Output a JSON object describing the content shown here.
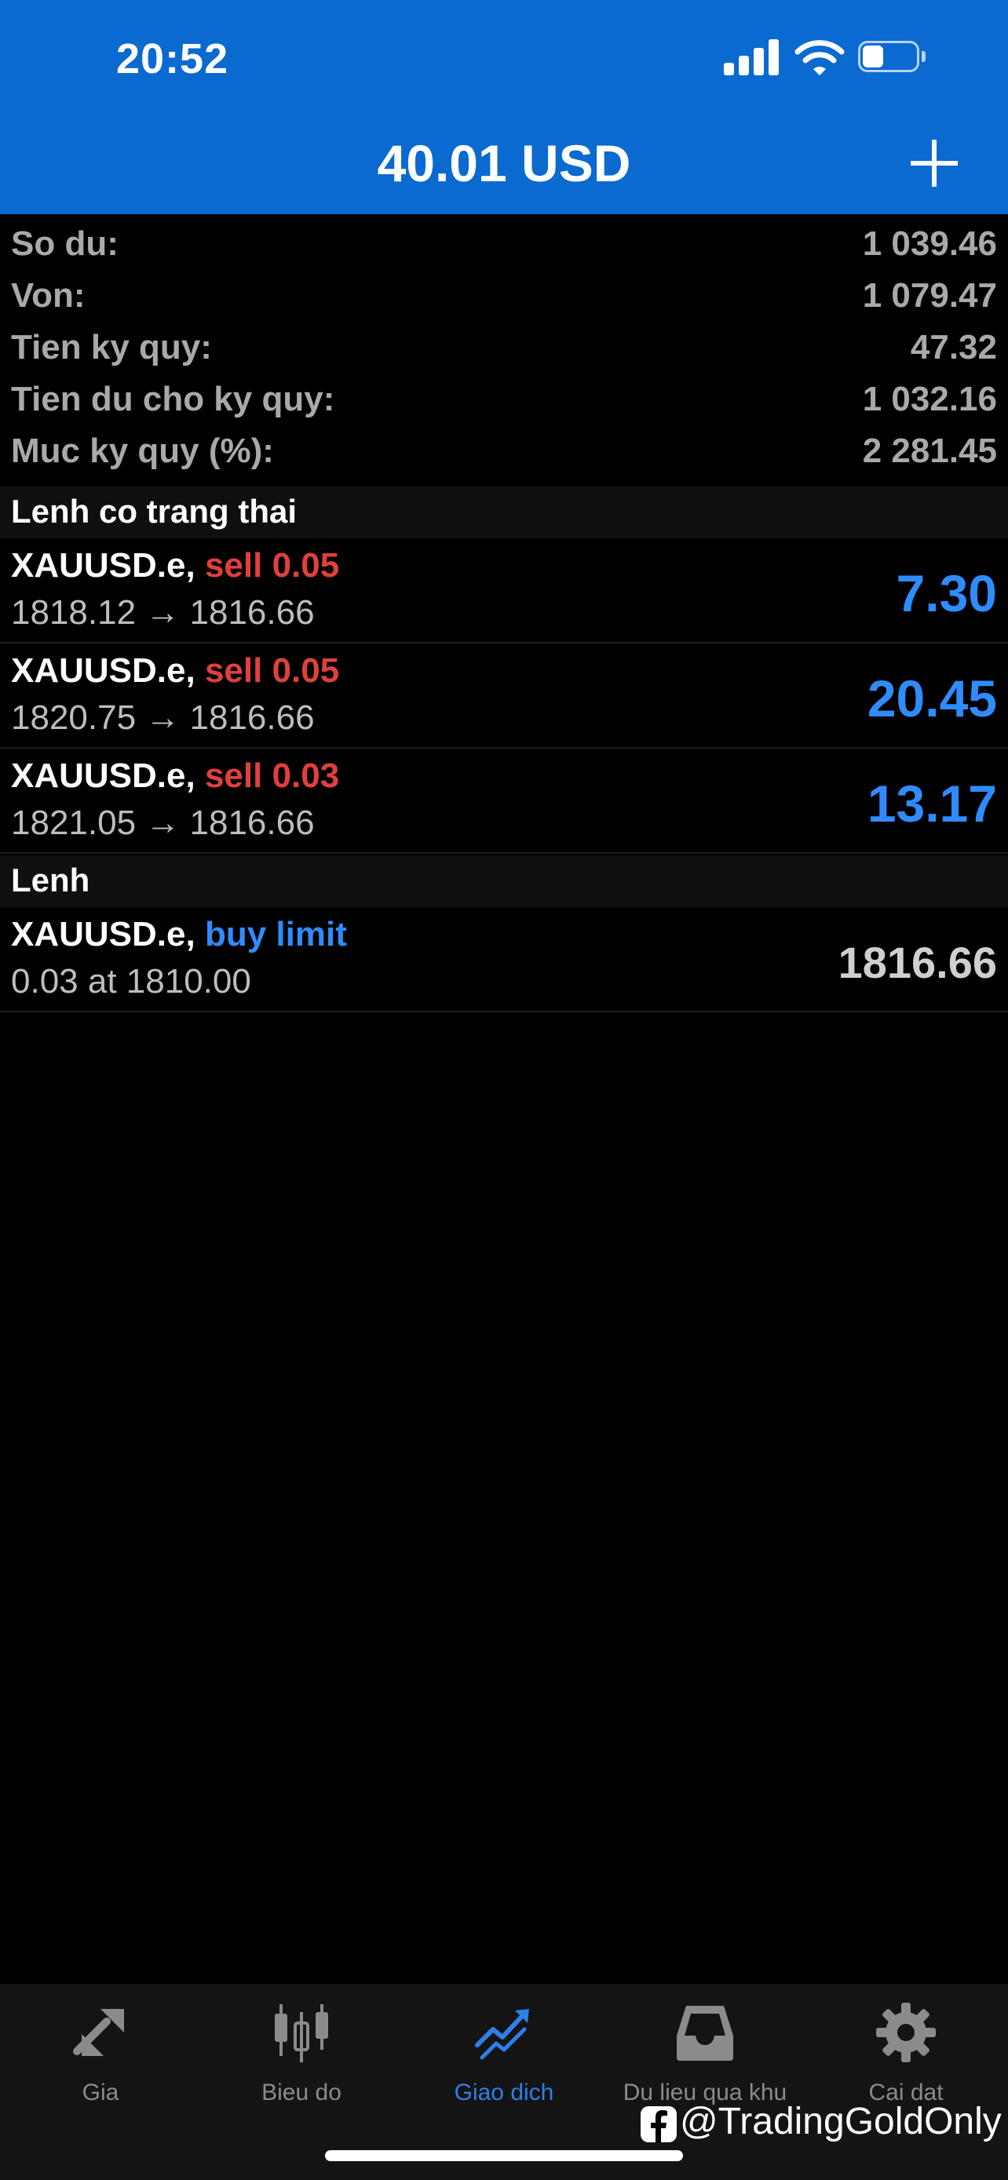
{
  "status_bar": {
    "time": "20:52",
    "battery_level": 0.4
  },
  "header": {
    "title": "40.01 USD",
    "add_icon": "plus-icon"
  },
  "summary": [
    {
      "label": "So du:",
      "value": "1 039.46"
    },
    {
      "label": "Von:",
      "value": "1 079.47"
    },
    {
      "label": "Tien ky quy:",
      "value": "47.32"
    },
    {
      "label": "Tien du cho ky quy:",
      "value": "1 032.16"
    },
    {
      "label": "Muc ky quy (%):",
      "value": "2 281.45"
    }
  ],
  "positions_section": {
    "title": "Lenh co trang thai"
  },
  "positions": [
    {
      "symbol": "XAUUSD.e,",
      "side": "sell 0.05",
      "prices": "1818.12 → 1816.66",
      "profit": "7.30"
    },
    {
      "symbol": "XAUUSD.e,",
      "side": "sell 0.05",
      "prices": "1820.75 → 1816.66",
      "profit": "20.45"
    },
    {
      "symbol": "XAUUSD.e,",
      "side": "sell 0.03",
      "prices": "1821.05 → 1816.66",
      "profit": "13.17"
    }
  ],
  "orders_section": {
    "title": "Lenh"
  },
  "orders": [
    {
      "symbol": "XAUUSD.e,",
      "side": "buy limit",
      "detail": "0.03 at 1810.00",
      "price": "1816.66"
    }
  ],
  "colors": {
    "header_blue": "#0a6ad0",
    "sell_red": "#e0403c",
    "accent_blue": "#2f8cff",
    "tab_active": "#2f7fe8"
  },
  "tabbar": [
    {
      "label": "Gia",
      "icon": "quotes-arrows-icon",
      "active": false
    },
    {
      "label": "Bieu do",
      "icon": "candlestick-chart-icon",
      "active": false
    },
    {
      "label": "Giao dich",
      "icon": "trade-trend-icon",
      "active": true
    },
    {
      "label": "Du lieu qua khu",
      "icon": "history-inbox-icon",
      "active": false
    },
    {
      "label": "Cai dat",
      "icon": "gear-icon",
      "active": false
    }
  ],
  "watermark": {
    "text": "@TradingGoldOnly",
    "icon": "facebook-icon"
  }
}
